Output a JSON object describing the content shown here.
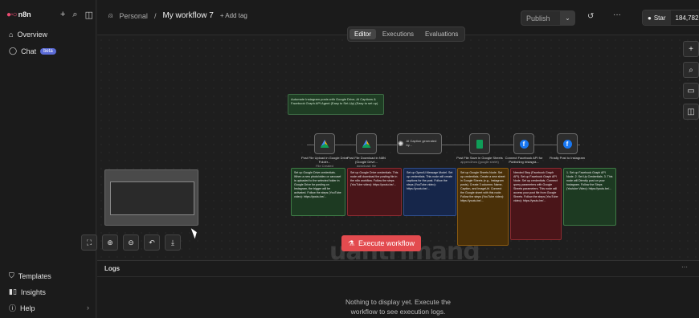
{
  "sidebar": {
    "logo": "n8n",
    "actions": [
      "+",
      "search-icon",
      "panel-icon"
    ],
    "items": [
      {
        "label": "Overview",
        "icon": "home-icon"
      },
      {
        "label": "Chat",
        "icon": "chat-icon",
        "badge": "beta"
      }
    ],
    "bottom": [
      {
        "label": "Templates",
        "icon": "templates-icon"
      },
      {
        "label": "Insights",
        "icon": "insights-icon"
      },
      {
        "label": "Help",
        "icon": "help-icon"
      }
    ]
  },
  "header": {
    "project": "Personal",
    "workflow_name": "My workflow 7",
    "add_tag": "+ Add tag",
    "publish_label": "Publish",
    "star_label": "Star",
    "star_count": "184,782"
  },
  "tabs": [
    {
      "label": "Editor",
      "active": true
    },
    {
      "label": "Executions",
      "active": false
    },
    {
      "label": "Evaluations",
      "active": false
    }
  ],
  "canvas": {
    "sticky_top": "Automate Instagram posts with Google Drive, AI Captions & Facebook Graph API Agent (Easy to Set-Up) (Easy to set up)",
    "nodes": [
      {
        "label": "Post File Upload in Google Drive Folder...",
        "sub": "File Created",
        "icon": "google-drive-icon"
      },
      {
        "label": "Post File Download in N8N (Google Drive...",
        "sub": "download: file",
        "icon": "google-drive-icon"
      },
      {
        "label": "AI Caption generated by...",
        "sub": "Message Model",
        "icon": "openai-icon"
      },
      {
        "label": "Post File Save in Google Sheets",
        "sub": "append/row (google sheet)",
        "icon": "google-sheets-icon"
      },
      {
        "label": "Connect Facebook API for Publishing Instagra...",
        "sub": "",
        "icon": "facebook-icon"
      },
      {
        "label": "Finally Post to Instagram",
        "sub": "",
        "icon": "facebook-icon"
      }
    ],
    "notes": [
      {
        "color": "green",
        "text": "Set up Google Drive credentials. When a new photo/video or carousel is uploaded to the selected folder in Google Drive for posting on Instagram, the trigger will be activated. Follow the steps (YouTube video): https://youtu.be/..."
      },
      {
        "color": "red",
        "text": "Set up Google Drive credentials. This node will download the posting file in the n8n workflow. Follow the steps (YouTube video): https://youtu.be/..."
      },
      {
        "color": "blue",
        "text": "Set up OpenAI Message Model. Set up credentials. This node will create captions for the post. Follow the steps (YouTube video): https://youtu.be/..."
      },
      {
        "color": "orange",
        "text": "Set up Google Sheets Node. Set up credentials. Create a new sheet in Google Sheets (e.g., Instagram posts). Create 3 columns: Name, Caption, and ImageUrl. Connect the Google sheet with this node. Follow the steps (YouTube video): https://youtu.be/..."
      },
      {
        "color": "red",
        "text": "Needed Step (Facebook Graph API). Set up Facebook Graph API Node. Set up credentials. Connect query parameters with Google Sheets parameters. This node will access your post file from Google Sheets. Follow the steps (YouTube video): https://youtu.be/..."
      },
      {
        "color": "green",
        "text": "1. Set up Facebook Graph API Node. 2. Set Up Credentials. 3. This node will Directly post on your Instagram. Follow the Steps (Youtube Video): https://youtu.be/..."
      }
    ],
    "execute_label": "Execute workflow",
    "right_tools": [
      "+",
      "search-icon",
      "sticky-note-icon",
      "panel-icon"
    ],
    "controls": [
      "fit-view-icon",
      "zoom-in-icon",
      "zoom-out-icon",
      "undo-icon",
      "tidy-up-icon"
    ]
  },
  "logs": {
    "title": "Logs",
    "empty_line1": "Nothing to display yet. Execute the",
    "empty_line2": "workflow to see execution logs."
  },
  "watermark": "uantrimang",
  "colors": {
    "accent": "#ea4b71",
    "execute": "#e34b4f",
    "beta": "#5b6bd6"
  }
}
